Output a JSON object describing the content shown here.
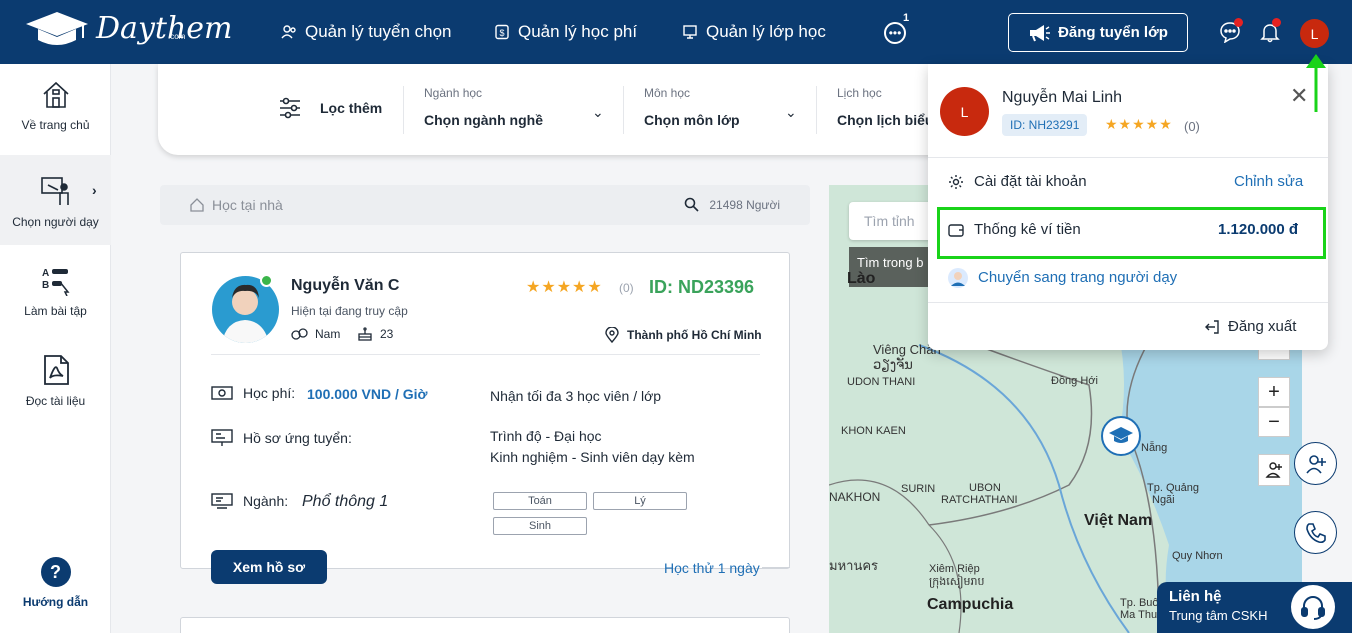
{
  "header": {
    "logo_text": "Daythem",
    "logo_sub": ".com",
    "nav": [
      {
        "label": "Quản lý tuyển chọn"
      },
      {
        "label": "Quản lý học phí"
      },
      {
        "label": "Quản lý lớp học"
      }
    ],
    "more_count": "1",
    "post_button": "Đăng tuyển lớp",
    "avatar_initial": "L"
  },
  "sidebar": {
    "items": [
      {
        "label": "Về trang chủ"
      },
      {
        "label": "Chọn người dạy"
      },
      {
        "label": "Làm bài tập"
      },
      {
        "label": "Đọc tài liệu"
      }
    ],
    "help_label": "Hướng dẫn",
    "help_glyph": "?"
  },
  "filter": {
    "more_label": "Lọc thêm",
    "groups": [
      {
        "caption": "Ngành học",
        "value": "Chọn ngành nghề"
      },
      {
        "caption": "Môn học",
        "value": "Chọn môn lớp"
      },
      {
        "caption": "Lịch học",
        "value": "Chọn lịch biểu"
      }
    ]
  },
  "search": {
    "placeholder": "Học tại nhà",
    "count": "21498 Người"
  },
  "tutor": {
    "name": "Nguyễn Văn C",
    "status": "Hiện tại đang truy cập",
    "gender": "Nam",
    "age": "23",
    "rating_stars": "★★★★★",
    "rating_count": "(0)",
    "id": "ID: ND23396",
    "location": "Thành phố Hồ Chí Minh",
    "fee_label": "Học phí:",
    "fee_value": "100.000 VND / Giờ",
    "capacity": "Nhận tối đa 3 học viên / lớp",
    "profile_label": "Hồ sơ ứng tuyển:",
    "education": "Trình độ - Đại học",
    "experience": "Kinh nghiệm - Sinh viên dạy kèm",
    "major_label": "Ngành:",
    "major_value": "Phổ thông 1",
    "subjects": [
      "Toán",
      "Lý",
      "Sinh"
    ],
    "view_button": "Xem hồ sơ",
    "trial": "Học thử 1 ngày"
  },
  "map": {
    "search_placeholder": "Tìm tỉnh",
    "overlay_text": "Tìm trong b",
    "labels": {
      "lao": "Lào",
      "vieng1": "Viêng Chăn",
      "vieng2": "ວຽງຈັນ",
      "udon": "UDON THANI",
      "donghoi": "Đồng Hới",
      "khon": "KHON KAEN",
      "danang": "Nẵng",
      "quang1": "Tp. Quảng",
      "quang2": "Ngãi",
      "nakhon": "NAKHON",
      "surin": "SURIN",
      "ubon1": "UBON",
      "ubon2": "RATCHATHANI",
      "vietnam": "Việt Nam",
      "quynhon": "Quy Nhơn",
      "maha": "มหานคร",
      "xiem1": "Xiêm Riệp",
      "xiem2": "ក្រុងសៀមរាប",
      "camp": "Campuchia",
      "buon1": "Tp. Buôn",
      "buon2": "Ma Thuột"
    },
    "zoom_in": "+",
    "zoom_out": "−"
  },
  "contact": {
    "title": "Liên hệ",
    "subtitle": "Trung tâm CSKH"
  },
  "account_panel": {
    "avatar_initial": "L",
    "name": "Nguyễn Mai Linh",
    "id": "ID: NH23291",
    "rating_stars": "★★★★★",
    "rating_count": "(0)",
    "close_glyph": "✕",
    "settings_label": "Cài đặt tài khoản",
    "edit_label": "Chỉnh sửa",
    "wallet_label": "Thống kê ví tiền",
    "wallet_amount": "1.120.000 đ",
    "switch_label": "Chuyển sang trang người dạy",
    "logout_label": "Đăng xuất"
  },
  "colors": {
    "primary": "#0b3b70",
    "accent_blue": "#1f6fb5",
    "green": "#3aa35b",
    "highlight": "#19d319",
    "avatar_red": "#c8290e",
    "star": "#f5a623"
  }
}
